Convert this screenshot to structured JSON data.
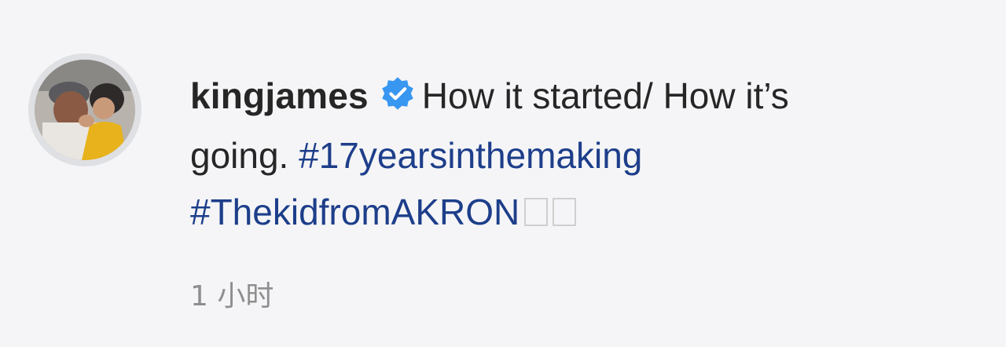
{
  "comment": {
    "avatar_icon": "profile-photo",
    "username": "kingjames",
    "verified_icon": "verified-badge-icon",
    "text_line1_rest": "How it started/ How it’s",
    "text_line2": "going.",
    "hashtags": [
      "#17yearsinthemaking",
      "#ThekidfromAKRON"
    ],
    "emoji_placeholders": [
      "□",
      "□"
    ],
    "timestamp": "1 小时"
  },
  "colors": {
    "text": "#262626",
    "hashtag": "#1d3e8a",
    "timestamp": "#8e8e8e",
    "verified": "#3897f0",
    "background": "#f5f5f7"
  }
}
